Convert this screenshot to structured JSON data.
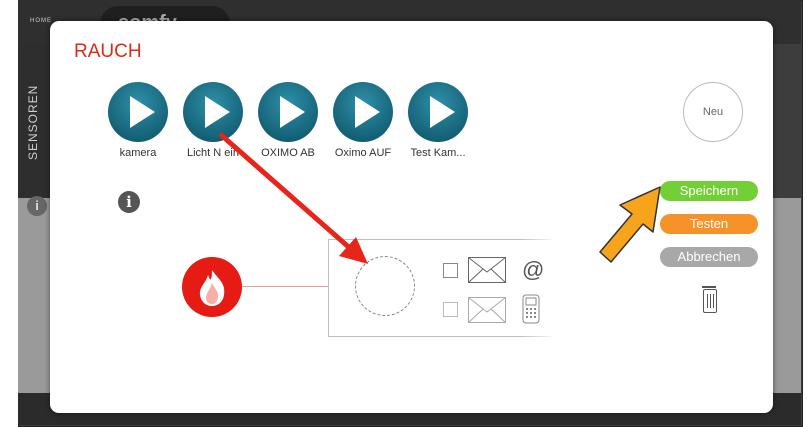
{
  "background": {
    "home_label": "HOME",
    "brand_text": "somfy",
    "side_label": "SENSOREN"
  },
  "modal": {
    "title": "RAUCH",
    "scenes": [
      {
        "label": "kamera"
      },
      {
        "label": "Licht N ein"
      },
      {
        "label": "OXIMO AB"
      },
      {
        "label": "Oximo AUF"
      },
      {
        "label": "Test Kam..."
      }
    ],
    "new_label": "Neu",
    "buttons": {
      "save": "Speichern",
      "test": "Testen",
      "cancel": "Abbrechen"
    },
    "email_symbol": "@"
  },
  "colors": {
    "title": "#e02a18",
    "save": "#72cf35",
    "test": "#f5922a",
    "cancel": "#a8a8a8",
    "scene": "#0a4f63",
    "annotation_arrow": "#e8251b",
    "pointer_arrow": "#f7a41d"
  }
}
